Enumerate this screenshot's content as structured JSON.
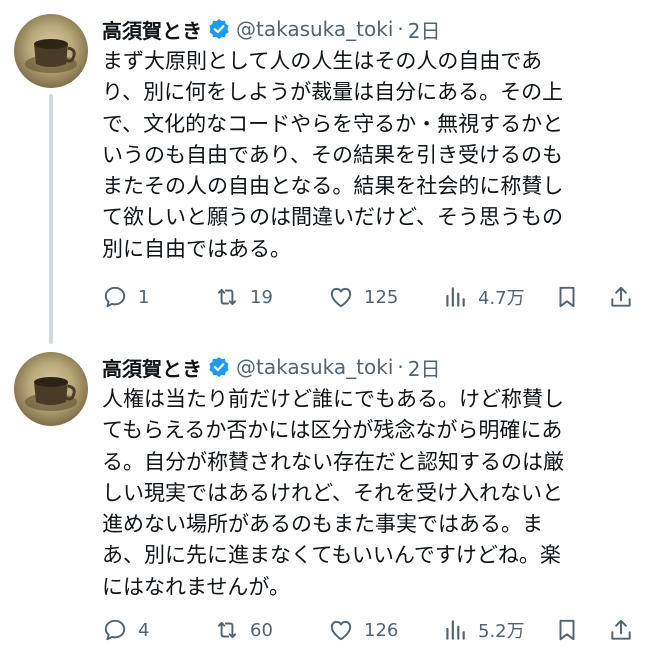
{
  "tweets": [
    {
      "author": {
        "name": "高須賀とき",
        "handle": "@takasuka_toki",
        "time": "2日",
        "verified": true
      },
      "text": "まず大原則として人の人生はその人の自由であ\nり、別に何をしようが裁量は自分にある。その上\nで、文化的なコードやらを守るか・無視するかと\nいうのも自由であり、その結果を引き受けるのも\nまたその人の自由となる。結果を社会的に称賛し\nて欲しいと願うのは間違いだけど、そう思うもの\n別に自由ではある。",
      "metrics": {
        "replies": "1",
        "retweets": "19",
        "likes": "125",
        "views": "4.7万"
      }
    },
    {
      "author": {
        "name": "高須賀とき",
        "handle": "@takasuka_toki",
        "time": "2日",
        "verified": true
      },
      "text": "人権は当たり前だけど誰にでもある。けど称賛し\nてもらえるか否かには区分が残念ながら明確にあ\nる。自分が称賛されない存在だと認知するのは厳\nしい現実ではあるけれど、それを受け入れないと\n進めない場所があるのもまた事実ではある。ま\nあ、別に先に進まなくてもいいんですけどね。楽\nにはなれませんが。",
      "metrics": {
        "replies": "4",
        "retweets": "60",
        "likes": "126",
        "views": "5.2万"
      }
    }
  ],
  "colors": {
    "text": "#0f1419",
    "secondary": "#536471",
    "verified": "#1d9bf0",
    "thread_line": "#cfd9de"
  },
  "icons": [
    "reply-icon",
    "retweet-icon",
    "like-icon",
    "views-icon",
    "bookmark-icon",
    "share-icon",
    "verified-badge-icon"
  ]
}
